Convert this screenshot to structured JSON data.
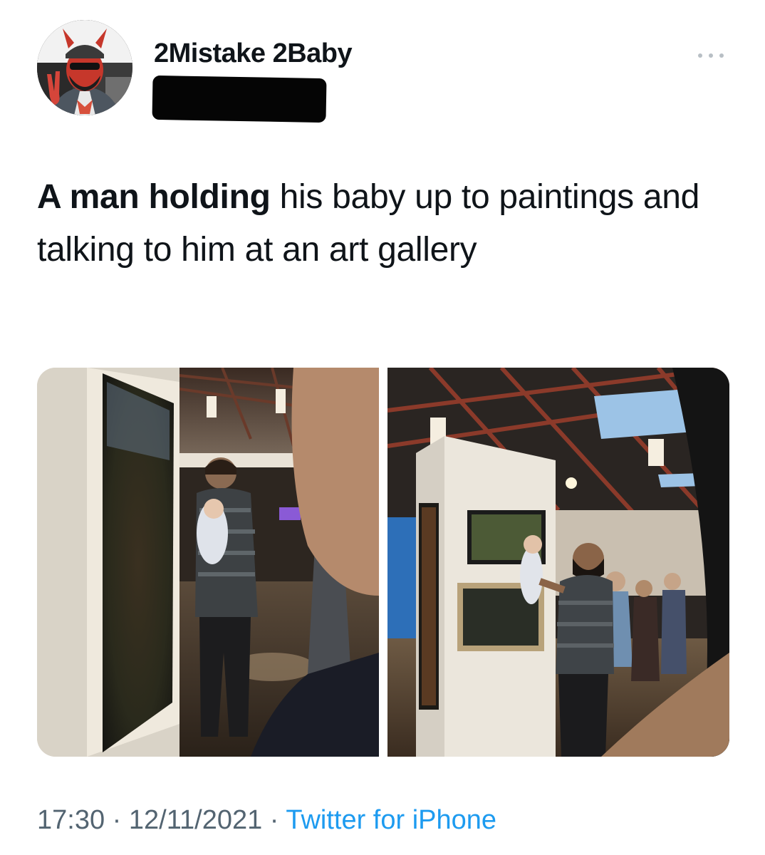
{
  "author": {
    "display_name": "2Mistake 2Baby",
    "avatar_icon": "devil-avatar-icon"
  },
  "tweet": {
    "text_bold": "A man holding",
    "text_rest": " his baby up to paintings and talking to him at an art gallery"
  },
  "media": {
    "count": 2,
    "photos": [
      "gallery-photo-left",
      "gallery-photo-right"
    ]
  },
  "meta": {
    "time": "17:30",
    "separator": " · ",
    "date": "12/11/2021",
    "source": "Twitter for iPhone"
  },
  "colors": {
    "text": "#0f1419",
    "secondary": "#536471",
    "link": "#1d9bf0",
    "redaction": "#050505"
  }
}
